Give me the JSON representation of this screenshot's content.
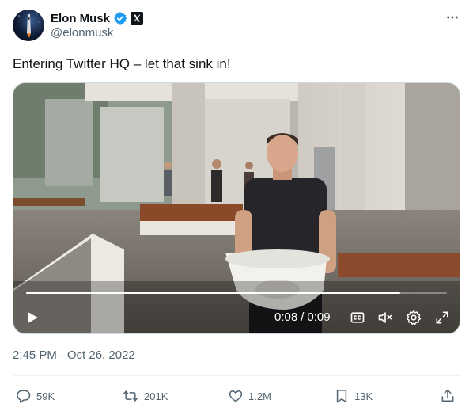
{
  "author": {
    "display_name": "Elon Musk",
    "handle": "@elonmusk",
    "verified_badge_color": "#1d9bf0",
    "affiliation_badge": "X"
  },
  "tweet": {
    "text": "Entering Twitter HQ – let that sink in!"
  },
  "video": {
    "current_time": "0:08",
    "separator": "/",
    "duration": "0:09",
    "progress": 0.89
  },
  "meta": {
    "time": "2:45 PM",
    "dot": "·",
    "date": "Oct 26, 2022"
  },
  "actions": {
    "replies": "59K",
    "reposts": "201K",
    "likes": "1.2M",
    "bookmarks": "13K"
  },
  "icons": {
    "more": "more-icon",
    "play": "play-icon",
    "captions": "captions-icon",
    "mute": "mute-icon",
    "settings": "settings-icon",
    "fullscreen": "fullscreen-icon",
    "reply": "reply-icon",
    "repost": "repost-icon",
    "like": "like-icon",
    "bookmark": "bookmark-icon",
    "share": "share-icon"
  }
}
